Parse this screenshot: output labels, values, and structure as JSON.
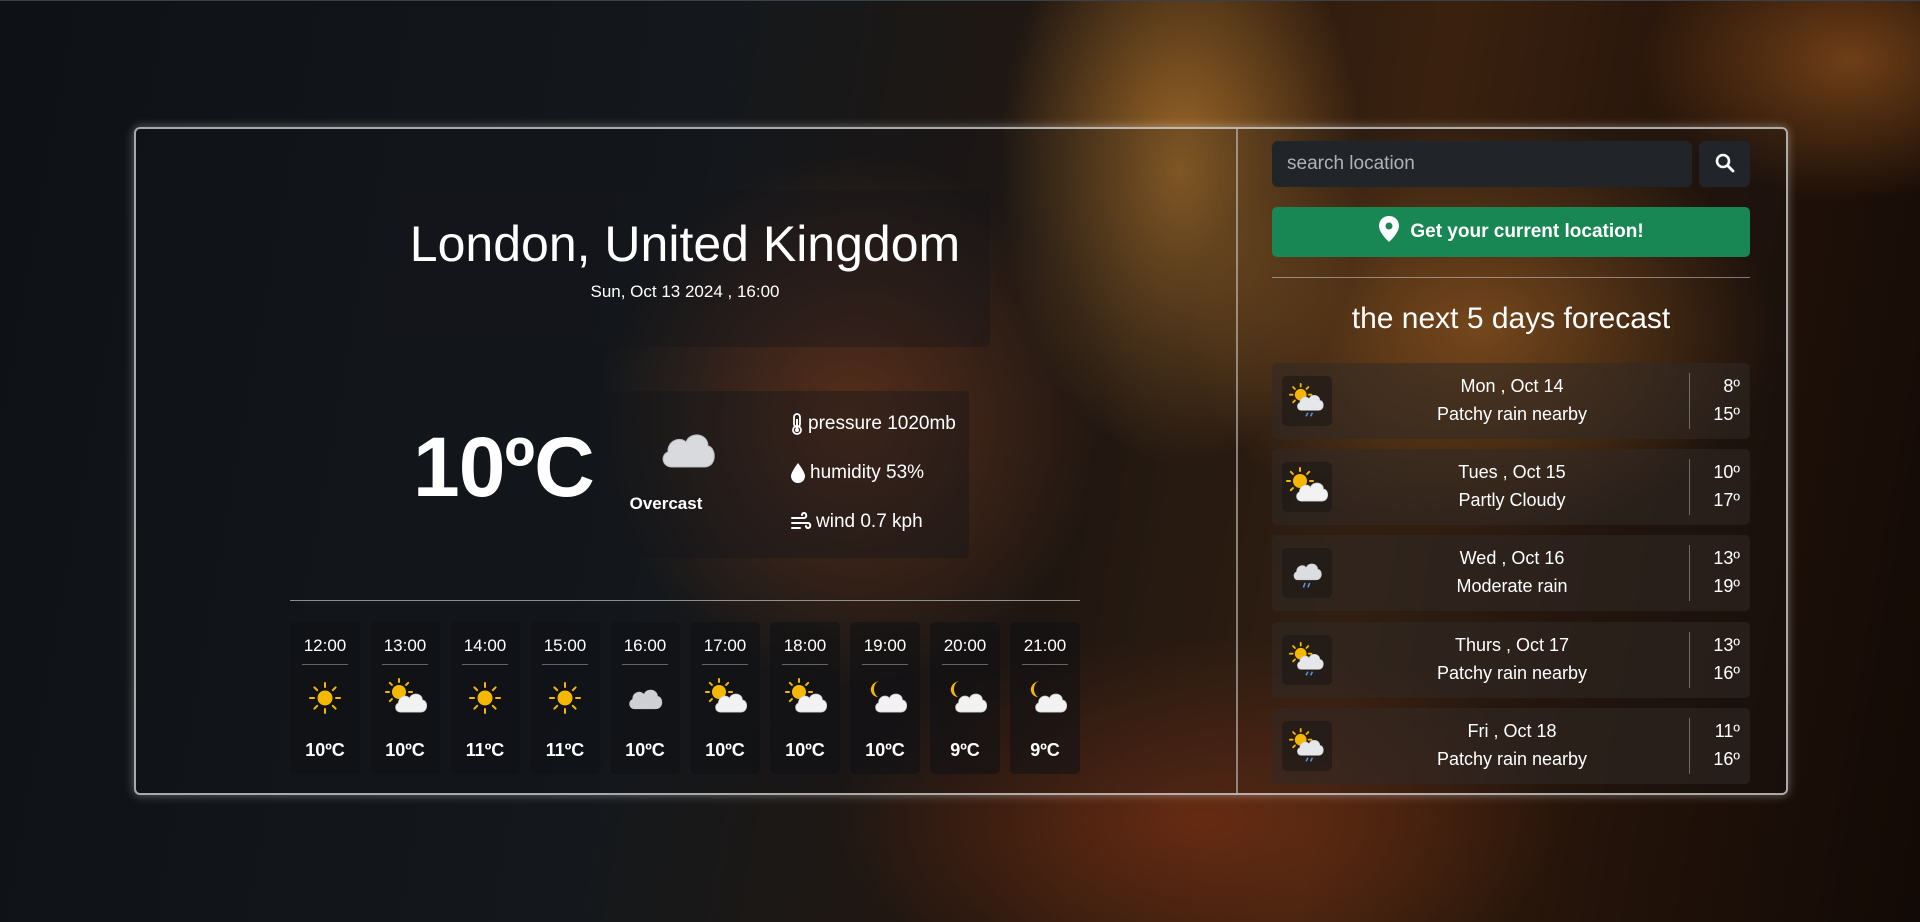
{
  "location": {
    "title": "London, United Kingdom",
    "datetime": "Sun, Oct 13 2024 , 16:00"
  },
  "current": {
    "temperature": "10ºC",
    "condition": "Overcast",
    "icon": "overcast-cloud-icon",
    "pressure": "pressure 1020mb",
    "humidity": "humidity 53%",
    "wind": "wind 0.7 kph"
  },
  "hourly": [
    {
      "time": "12:00",
      "icon": "sun-icon",
      "temp": "10ºC"
    },
    {
      "time": "13:00",
      "icon": "partly-cloudy-icon",
      "temp": "10ºC"
    },
    {
      "time": "14:00",
      "icon": "sun-icon",
      "temp": "11ºC"
    },
    {
      "time": "15:00",
      "icon": "sun-icon",
      "temp": "11ºC"
    },
    {
      "time": "16:00",
      "icon": "cloud-icon",
      "temp": "10ºC"
    },
    {
      "time": "17:00",
      "icon": "partly-cloudy-icon",
      "temp": "10ºC"
    },
    {
      "time": "18:00",
      "icon": "partly-cloudy-icon",
      "temp": "10ºC"
    },
    {
      "time": "19:00",
      "icon": "night-cloudy-icon",
      "temp": "10ºC"
    },
    {
      "time": "20:00",
      "icon": "night-cloudy-icon",
      "temp": "9ºC"
    },
    {
      "time": "21:00",
      "icon": "night-cloudy-icon",
      "temp": "9ºC"
    }
  ],
  "search": {
    "placeholder": "search location",
    "value": ""
  },
  "current_location_button": "Get your current location!",
  "forecast": {
    "title": "the next 5 days forecast",
    "days": [
      {
        "date": "Mon , Oct 14",
        "condition": "Patchy rain nearby",
        "low": "8º",
        "high": "15º",
        "icon": "sun-cloud-rain-icon"
      },
      {
        "date": "Tues , Oct 15",
        "condition": "Partly Cloudy",
        "low": "10º",
        "high": "17º",
        "icon": "partly-cloudy-icon"
      },
      {
        "date": "Wed , Oct 16",
        "condition": "Moderate rain",
        "low": "13º",
        "high": "19º",
        "icon": "rain-cloud-icon"
      },
      {
        "date": "Thurs , Oct 17",
        "condition": "Patchy rain nearby",
        "low": "13º",
        "high": "16º",
        "icon": "sun-cloud-rain-icon"
      },
      {
        "date": "Fri , Oct 18",
        "condition": "Patchy rain nearby",
        "low": "11º",
        "high": "16º",
        "icon": "sun-cloud-rain-icon"
      }
    ]
  },
  "colors": {
    "accent_green": "#198754",
    "input_bg": "#212429",
    "sun": "#f5b800",
    "cloud": "#f2f2f2",
    "rain": "#5b8fd8"
  }
}
